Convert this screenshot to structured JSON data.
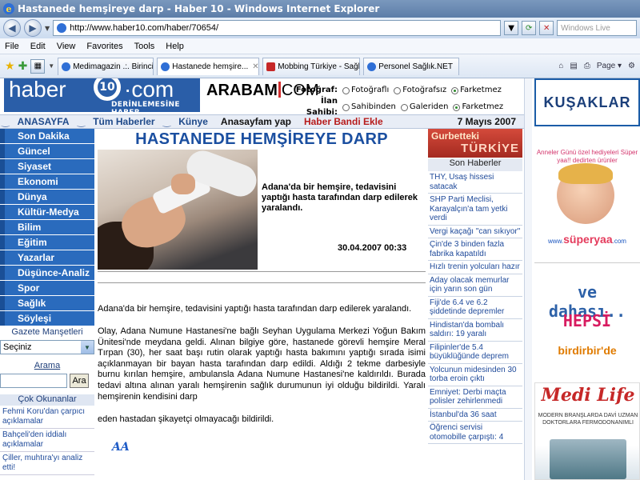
{
  "window": {
    "title": "Hastanede hemşireye darp - Haber 10 - Windows Internet Explorer",
    "url": "http://www.haber10.com/haber/70654/",
    "search_placeholder": "Windows Live"
  },
  "menu": [
    "File",
    "Edit",
    "View",
    "Favorites",
    "Tools",
    "Help"
  ],
  "tabs": [
    {
      "label": "Medimagazin .:. Birinci ...",
      "active": false
    },
    {
      "label": "Hastanede hemşire...",
      "active": true
    },
    {
      "label": "Mobbing Türkiye - Sağlı...",
      "active": false
    },
    {
      "label": "Personel Sağlık.NET",
      "active": false
    }
  ],
  "toolbar_right": {
    "page_label": "Page"
  },
  "header": {
    "logo_haber": "haber",
    "logo_num": "10",
    "logo_com": "com",
    "logo_tagline": "DERİNLEMESİNE HABER",
    "arabam": "ARABAM",
    "arabam_com": "COM",
    "fotograf_label": "Fotoğraf:",
    "fotograf_opts": [
      "Fotoğraflı",
      "Fotoğrafsız",
      "Farketmez"
    ],
    "ilan_label": "İlan Sahibi:",
    "ilan_opts": [
      "Sahibinden",
      "Galeriden",
      "Farketmez"
    ]
  },
  "navstrip": {
    "anasayfa": "ANASAYFA",
    "tum": "Tüm Haberler",
    "kunye": "Künye",
    "anasayfa_yap": "Anasayfam yap",
    "haber_bandi": "Haber Bandi Ekle",
    "date": "7 Mayıs 2007"
  },
  "left_menu": [
    "Son Dakika",
    "Güncel",
    "Siyaset",
    "Ekonomi",
    "Dünya",
    "Kültür-Medya",
    "Bilim",
    "Eğitim",
    "Yazarlar",
    "Düşünce-Analiz",
    "Spor",
    "Sağlık",
    "Söyleşi"
  ],
  "gazete": {
    "label": "Gazete Manşetleri",
    "selected": "Seçiniz"
  },
  "arama": {
    "label": "Arama",
    "button": "Ara"
  },
  "cok_okunanlar": {
    "title": "Çok Okunanlar",
    "items": [
      "Fehmi Koru'dan çarpıcı açıklamalar",
      "Bahçeli'den iddialı açıklamalar",
      "Çiller, muhtıra'yı analiz etti!"
    ]
  },
  "article": {
    "headline": "HASTANEDE HEMŞİREYE DARP",
    "summary": "Adana'da bir hemşire, tedavisini yaptığı hasta tarafından darp edilerek yaralandı.",
    "datetime": "30.04.2007 00:33",
    "lead": "Adana'da bir hemşire, tedavisini yaptığı hasta tarafından darp edilerek yaralandı.",
    "body": "Olay, Adana Numune Hastanesi'ne bağlı Seyhan Uygulama Merkezi Yoğun Bakım Ünitesi'nde meydana geldi. Alınan bilgiye göre, hastanede görevli hemşire Meral Tırpan (30), her saat başı rutin olarak yaptığı hasta bakımını yaptığı sırada isimi açıklanmayan bir bayan hasta tarafından darp edildi. Aldığı 2 tekme darbesiyle burnu kırılan hemşire, ambulansla Adana Numune Hastanesi'ne kaldırıldı. Burada tedavi altına alınan yaralı hemşirenin sağlık durumunun iyi olduğu bildirildi. Yaralı hemşirenin kendisini darp",
    "body2": "eden hastadan şikayetçi olmayacağı bildirildi.",
    "source_logo": "AA"
  },
  "right_col": {
    "gurbet1": "Gurbetteki",
    "gurbet2": "TÜRKİYE",
    "son_haberler": "Son Haberler",
    "news": [
      "THY, Usaş hissesi satacak",
      "SHP Parti Meclisi, Karayalçın'a tam yetki verdi",
      "Vergi kaçağı \"can sıkıyor\"",
      "Çin'de 3 binden fazla fabrika kapatıldı",
      "Hızlı trenin yolcuları hazır",
      "Aday olacak memurlar için yarın son gün",
      "Fiji'de 6.4 ve 6.2 şiddetinde depremler",
      "Hindistan'da bombalı saldırı: 19 yaralı",
      "Filipinler'de 5.4 büyüklüğünde deprem",
      "Yolcunun midesinden 30 torba eroin çıktı",
      "Emniyet: Derbi maçta polisler zehirlenmedi",
      "İstanbul'da 36 saat",
      "Öğrenci servisi otomobille çarpıştı: 4"
    ]
  },
  "ads": {
    "kusaklar": "KUŞAKLAR",
    "anneler": "Anneler Günü özel hediyeleri Süper yaa!! dedirten ürünler",
    "superyaa_www": "www.",
    "superyaa": "süperyaa",
    "superyaa_com": ".com",
    "vedahasi": "ve dahası..",
    "hepsi": "HEPSİ",
    "birdirbir": "birdirbir'de",
    "medilife": "Medi Life",
    "medilife_sub": "MODERN BRANŞLARDA DAVİ UZMAN DOKTORLARA FERMODONANIMLI"
  },
  "colors": {
    "brand_blue": "#2a6bbd",
    "headline_blue": "#1b4fa0",
    "red": "#c62828"
  }
}
